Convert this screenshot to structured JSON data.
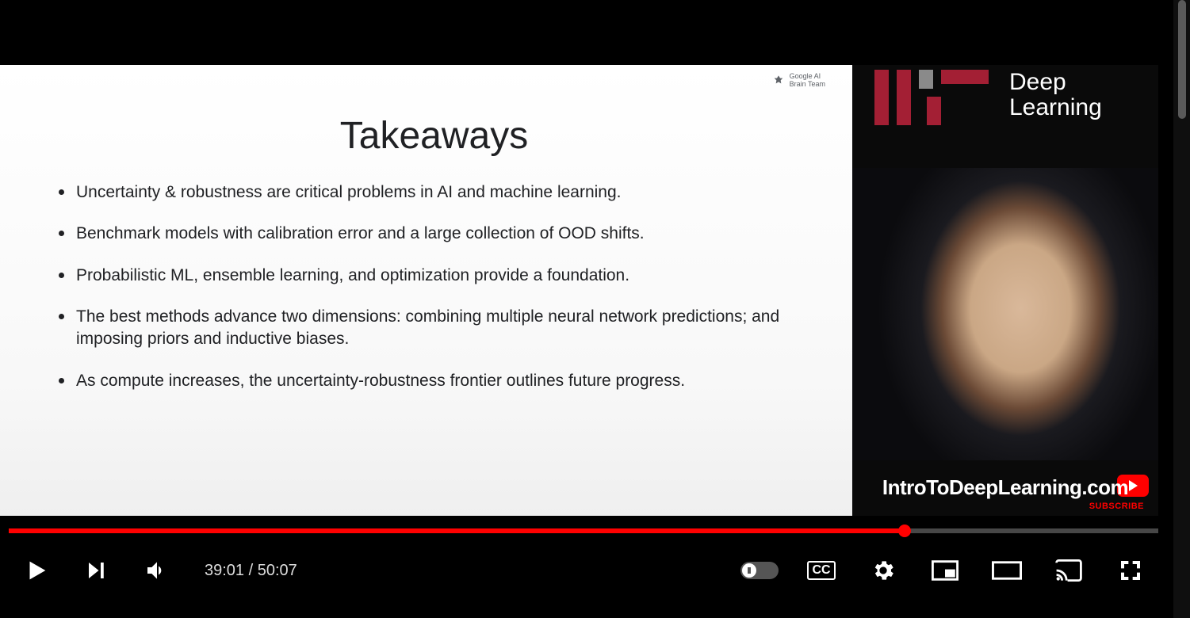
{
  "slide": {
    "header_line1": "Google AI",
    "header_line2": "Brain Team",
    "title": "Takeaways",
    "bullets": [
      "Uncertainty & robustness are critical problems in AI and machine learning.",
      "Benchmark models with calibration error and a large collection of OOD shifts.",
      "Probabilistic ML, ensemble learning, and optimization provide a foundation.",
      "The best methods advance two dimensions: combining multiple neural network predictions; and imposing priors and inductive biases.",
      "As compute increases, the uncertainty-robustness frontier outlines future progress."
    ]
  },
  "speaker_overlay": {
    "brand_line1": "Deep",
    "brand_line2": "Learning",
    "url": "IntroToDeepLearning.com",
    "subscribe": "SUBSCRIBE"
  },
  "player": {
    "current_time": "39:01",
    "duration": "50:07",
    "time_display": "39:01 / 50:07",
    "progress_percent": 77.9,
    "autoplay": false,
    "cc_label": "CC"
  }
}
